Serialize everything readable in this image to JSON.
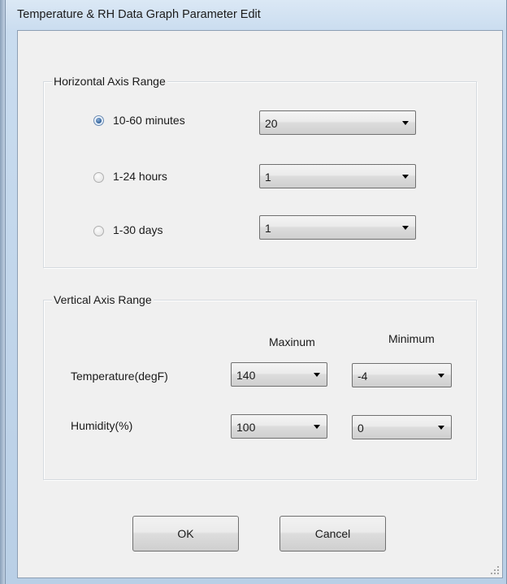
{
  "window": {
    "title": "Temperature & RH Data Graph Parameter Edit"
  },
  "horizontal": {
    "group_label": "Horizontal Axis Range",
    "options": [
      {
        "label": "10-60 minutes",
        "checked": true,
        "value": "20"
      },
      {
        "label": "1-24 hours",
        "checked": false,
        "value": "1"
      },
      {
        "label": "1-30 days",
        "checked": false,
        "value": "1"
      }
    ]
  },
  "vertical": {
    "group_label": "Vertical Axis Range",
    "col_max": "Maxinum",
    "col_min": "Minimum",
    "rows": [
      {
        "label": "Temperature(degF)",
        "max": "140",
        "min": "-4"
      },
      {
        "label": "Humidity(%)",
        "max": "100",
        "min": "0"
      }
    ]
  },
  "buttons": {
    "ok": "OK",
    "cancel": "Cancel"
  }
}
